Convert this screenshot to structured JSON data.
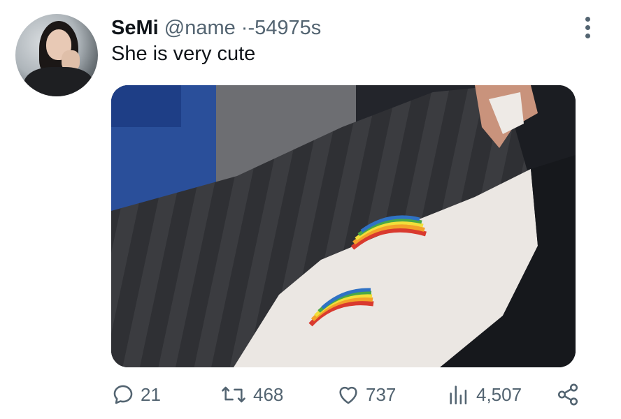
{
  "tweet": {
    "author_name": "SeMi",
    "handle": "@name",
    "separator": "·",
    "time": "-54975s",
    "text": "She is very cute"
  },
  "stats": {
    "replies": "21",
    "retweets": "468",
    "likes": "737",
    "views": "4,507"
  },
  "icons": {
    "more": "more-vertical-icon",
    "reply": "reply-bubble-icon",
    "retweet": "retweet-icon",
    "like": "heart-icon",
    "views": "analytics-icon",
    "share": "share-icon"
  },
  "colors": {
    "text": "#0f1419",
    "secondary": "#536471",
    "background": "#ffffff"
  }
}
